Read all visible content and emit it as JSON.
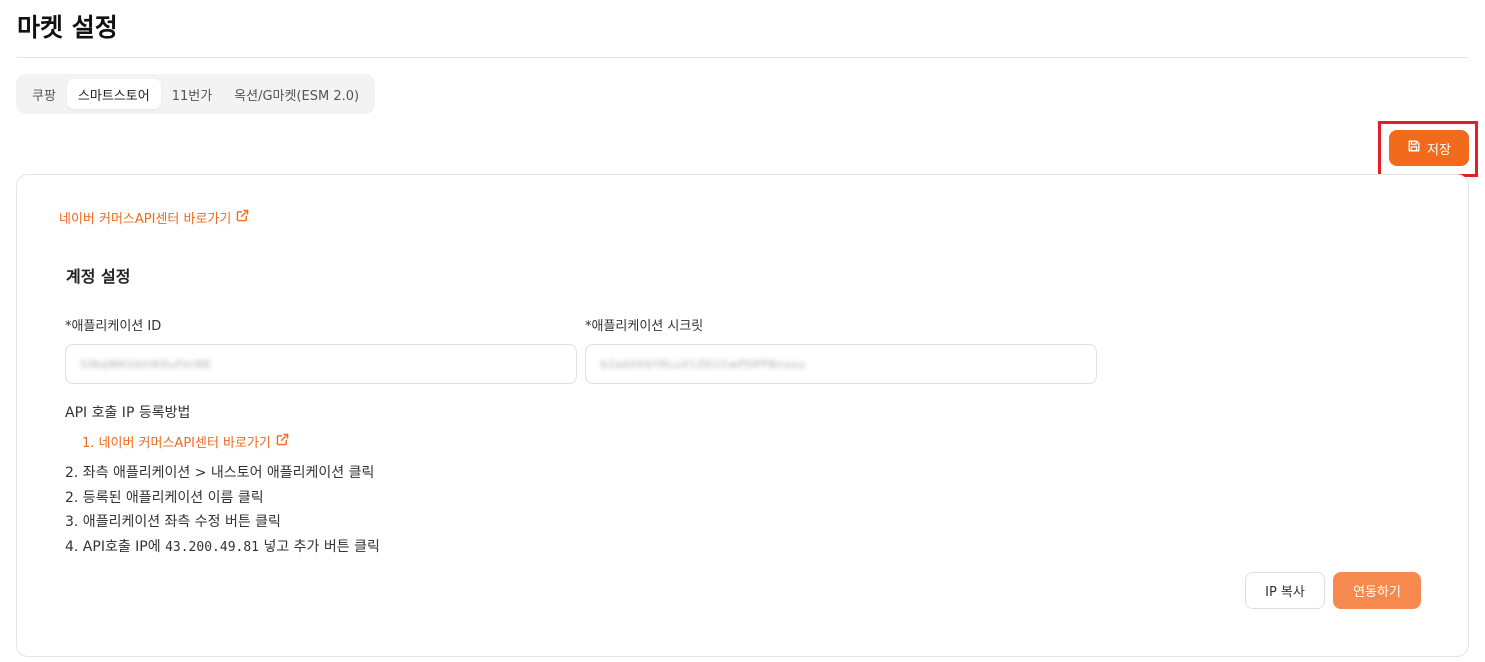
{
  "header": {
    "title": "마켓 설정"
  },
  "tabs": [
    {
      "label": "쿠팡",
      "active": false
    },
    {
      "label": "스마트스토어",
      "active": true
    },
    {
      "label": "11번가",
      "active": false
    },
    {
      "label": "옥션/G마켓(ESM 2.0)",
      "active": false
    }
  ],
  "toolbar": {
    "save_label": "저장",
    "save_icon": "save-icon"
  },
  "card": {
    "commerce_link": "네이버 커머스API센터 바로가기",
    "section_title": "계정 설정",
    "fields": {
      "app_id": {
        "label": "*애플리케이션 ID",
        "value": "5iNqWKGkhlK0uFbrNE"
      },
      "app_secret": {
        "label": "*애플리케이션 시크릿",
        "value": "$2a$04$YRLuX1ZEU1wPDPPBnxxu"
      }
    },
    "howto": {
      "title": "API 호출 IP 등록방법",
      "step1_link": "1. 네이버 커머스API센터 바로가기",
      "steps": [
        "2. 좌측 애플리케이션 > 내스토어 애플리케이션 클릭",
        "2. 등록된 애플리케이션 이름 클릭",
        "3. 애플리케이션 좌측 수정 버튼 클릭"
      ],
      "step4_prefix": "4. API호출 IP에 ",
      "step4_ip": "43.200.49.81",
      "step4_suffix": " 넣고 추가 버튼 클릭"
    },
    "ip_copy_label": "IP 복사",
    "connect_label": "연동하기"
  },
  "colors": {
    "accent": "#f26a1b",
    "accent_light": "#f68a4e",
    "link": "#ef6b1f",
    "highlight": "#e51d24"
  }
}
